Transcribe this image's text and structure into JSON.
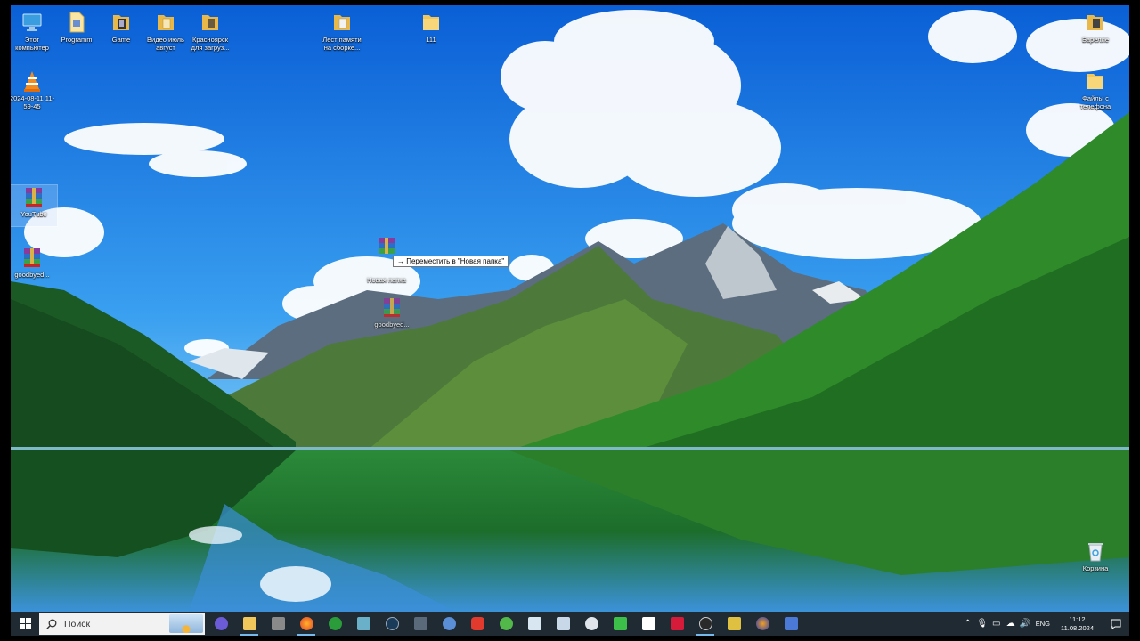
{
  "desktop": {
    "icons": {
      "this_pc": "Этот компьютер",
      "programm": "Programm",
      "game": "Game",
      "video": "Видео июль август",
      "krasnoyarsk": "Красноярск для загруз...",
      "lest": "Лест памяти на сборке...",
      "f111": "111",
      "barelle": "Барелле",
      "files_phone": "Файлы с телефона",
      "vlc_file": "2024-08-11 11-59-45",
      "youtube_rar": "YouTube",
      "goodbye_rar_left": "goodbyed...",
      "new_folder": "Новая папка",
      "goodbye_rar_mid": "goodbyed...",
      "recycle": "Корзина"
    },
    "drag_tooltip": "→ Переместить в \"Новая папка\""
  },
  "taskbar": {
    "search_placeholder": "Поиск",
    "language": "ENG",
    "time": "11:12",
    "date": "11.08.2024"
  },
  "colors": {
    "taskbar_bg": "#1f2a33",
    "accent": "#76b9ed",
    "folder": "#f1c75b"
  }
}
